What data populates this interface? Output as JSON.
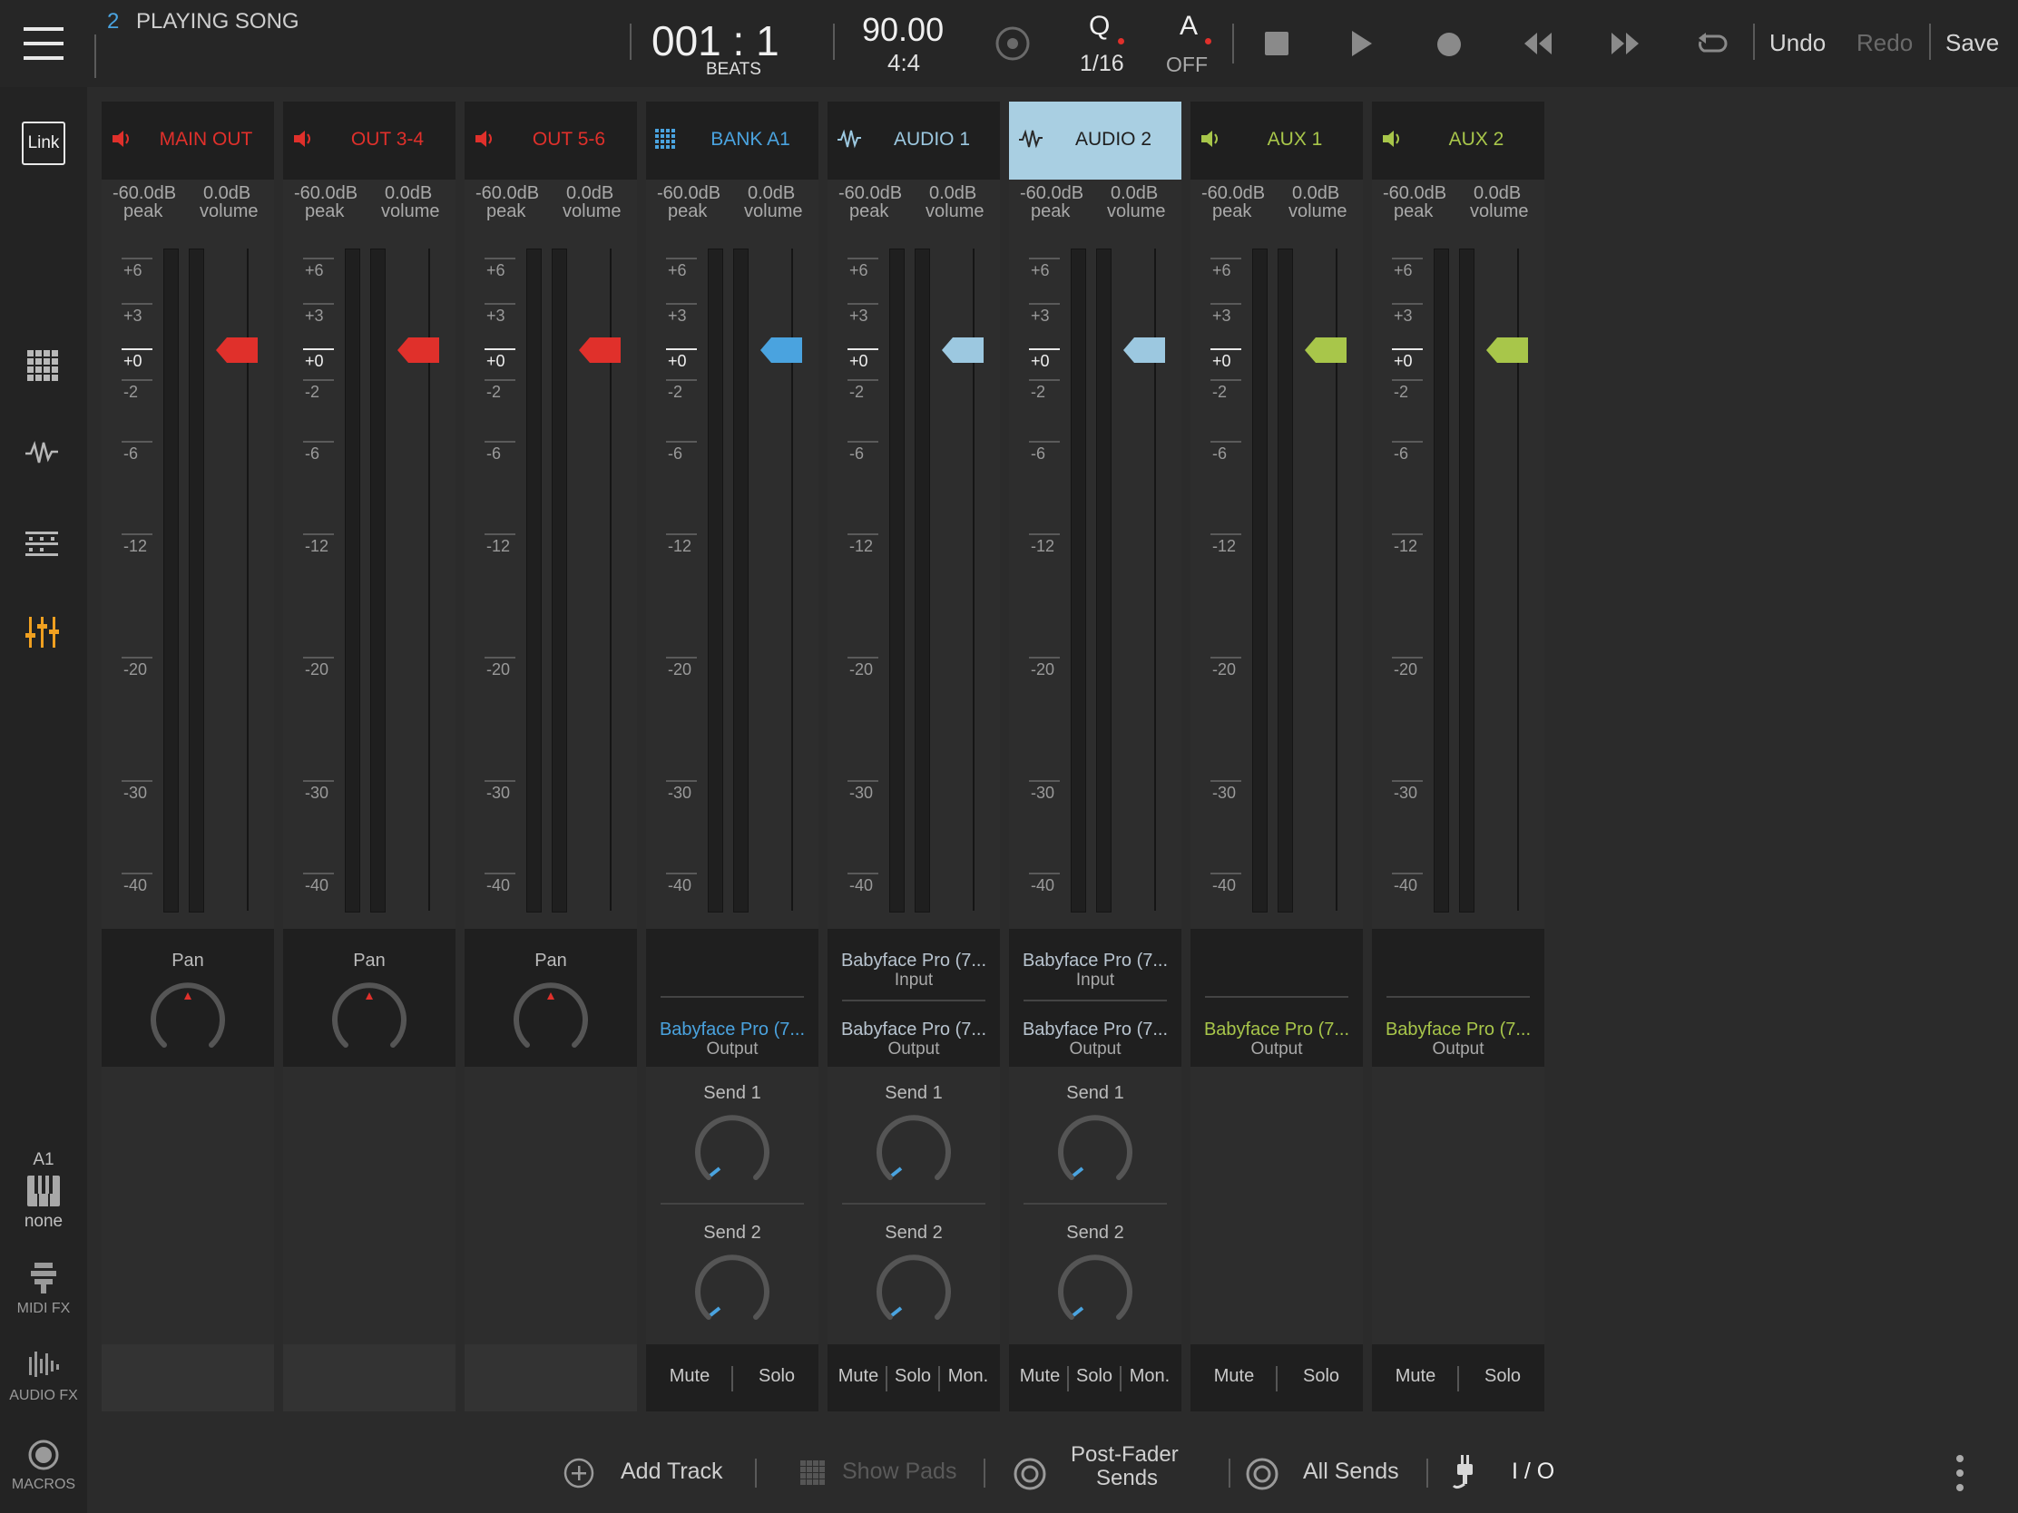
{
  "song": {
    "number": "2",
    "title": "PLAYING SONG"
  },
  "transport": {
    "position": "001 : 1",
    "position_unit": "BEATS",
    "tempo": "90.00",
    "time_signature": "4:4",
    "quantize_label": "Q",
    "quantize_value": "1/16",
    "auto_label": "A",
    "auto_value": "OFF",
    "undo": "Undo",
    "redo": "Redo",
    "save": "Save"
  },
  "sidebar": {
    "link_label": "Link",
    "keys_track": "A1",
    "keys_value": "none",
    "midi_fx": "MIDI FX",
    "audio_fx": "AUDIO FX",
    "macros": "MACROS"
  },
  "colors": {
    "red": "#e0302b",
    "blue": "#4aa3df",
    "lightblue": "#9cc8e0",
    "green": "#a8c64a"
  },
  "ticks": [
    "+6",
    "+3",
    "+0",
    "-2",
    "-6",
    "-12",
    "-20",
    "-30",
    "-40"
  ],
  "channels": [
    {
      "name": "MAIN OUT",
      "type": "output",
      "color": "#e0302b",
      "icon": "speaker-icon",
      "peak": "-60.0dB",
      "peak_label": "peak",
      "volume": "0.0dB",
      "volume_label": "volume",
      "pan_label": "Pan"
    },
    {
      "name": "OUT 3-4",
      "type": "output",
      "color": "#e0302b",
      "icon": "speaker-icon",
      "peak": "-60.0dB",
      "peak_label": "peak",
      "volume": "0.0dB",
      "volume_label": "volume",
      "pan_label": "Pan"
    },
    {
      "name": "OUT 5-6",
      "type": "output",
      "color": "#e0302b",
      "icon": "speaker-icon",
      "peak": "-60.0dB",
      "peak_label": "peak",
      "volume": "0.0dB",
      "volume_label": "volume",
      "pan_label": "Pan"
    },
    {
      "name": "BANK A1",
      "type": "bank",
      "color": "#4aa3df",
      "icon": "grid-icon",
      "peak": "-60.0dB",
      "peak_label": "peak",
      "volume": "0.0dB",
      "volume_label": "volume",
      "output": "Babyface Pro (7...",
      "output_label": "Output",
      "send1": "Send 1",
      "send2": "Send 2",
      "mute": "Mute",
      "solo": "Solo"
    },
    {
      "name": "AUDIO 1",
      "type": "audio",
      "color": "#9cc8e0",
      "icon": "waveform-icon",
      "peak": "-60.0dB",
      "peak_label": "peak",
      "volume": "0.0dB",
      "volume_label": "volume",
      "input": "Babyface Pro (7...",
      "input_label": "Input",
      "output": "Babyface Pro (7...",
      "output_label": "Output",
      "send1": "Send 1",
      "send2": "Send 2",
      "mute": "Mute",
      "solo": "Solo",
      "mon": "Mon."
    },
    {
      "name": "AUDIO 2",
      "type": "audio",
      "selected": true,
      "color": "#9cc8e0",
      "icon": "waveform-icon",
      "peak": "-60.0dB",
      "peak_label": "peak",
      "volume": "0.0dB",
      "volume_label": "volume",
      "input": "Babyface Pro (7...",
      "input_label": "Input",
      "output": "Babyface Pro (7...",
      "output_label": "Output",
      "send1": "Send 1",
      "send2": "Send 2",
      "mute": "Mute",
      "solo": "Solo",
      "mon": "Mon."
    },
    {
      "name": "AUX 1",
      "type": "aux",
      "color": "#a8c64a",
      "icon": "speaker-icon",
      "peak": "-60.0dB",
      "peak_label": "peak",
      "volume": "0.0dB",
      "volume_label": "volume",
      "output": "Babyface Pro (7...",
      "output_label": "Output",
      "mute": "Mute",
      "solo": "Solo"
    },
    {
      "name": "AUX 2",
      "type": "aux",
      "color": "#a8c64a",
      "icon": "speaker-icon",
      "peak": "-60.0dB",
      "peak_label": "peak",
      "volume": "0.0dB",
      "volume_label": "volume",
      "output": "Babyface Pro (7...",
      "output_label": "Output",
      "mute": "Mute",
      "solo": "Solo"
    }
  ],
  "bottombar": {
    "add_track": "Add Track",
    "show_pads": "Show Pads",
    "post_fader_1": "Post-Fader",
    "post_fader_2": "Sends",
    "all_sends": "All Sends",
    "io": "I / O"
  }
}
